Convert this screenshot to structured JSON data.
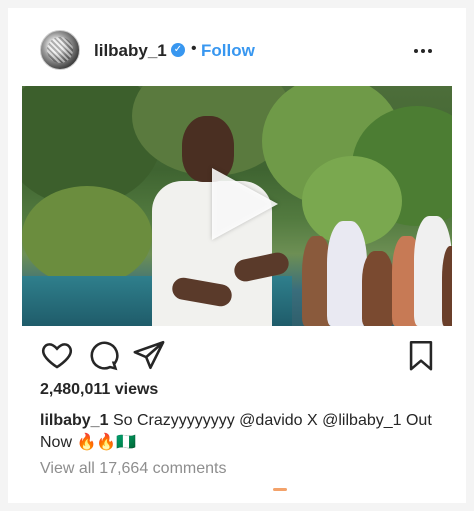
{
  "post": {
    "username": "lilbaby_1",
    "verified_icon": "verified-badge-icon",
    "separator": "•",
    "follow_label": "Follow",
    "more_icon": "more-options-icon"
  },
  "media": {
    "type": "video",
    "play_icon": "play-icon"
  },
  "actions": {
    "like_icon": "heart-icon",
    "comment_icon": "comment-icon",
    "share_icon": "send-icon",
    "save_icon": "bookmark-icon"
  },
  "stats": {
    "views": "2,480,011 views"
  },
  "caption": {
    "user": "lilbaby_1",
    "text": "So Crazyyyyyyyy @davido X @lilbaby_1 Out Now 🔥🔥🇳🇬"
  },
  "comments": {
    "view_all": "View all 17,664 comments"
  },
  "colors": {
    "link_blue": "#3897f0",
    "text": "#262626",
    "muted": "#8e8e8e"
  }
}
